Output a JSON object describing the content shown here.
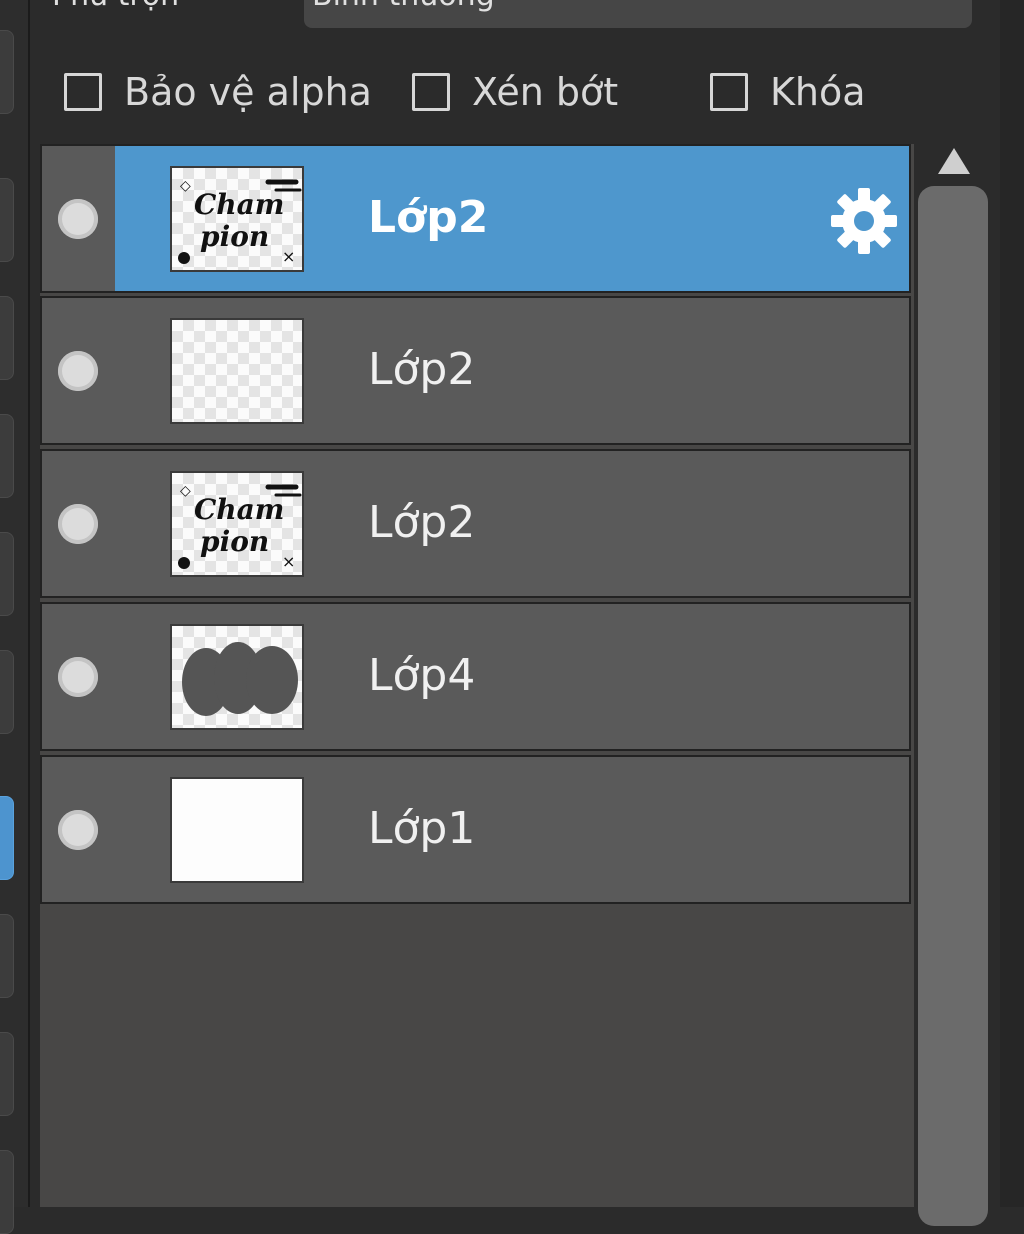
{
  "blend": {
    "label": "Phủ trộn",
    "value": "Bình thường"
  },
  "options": {
    "protect_alpha": "Bảo vệ alpha",
    "clipping": "Xén bớt",
    "lock": "Khóa"
  },
  "layers": [
    {
      "name": "Lớp2",
      "selected": true,
      "thumbnail": "champion-text-icon"
    },
    {
      "name": "Lớp2",
      "selected": false,
      "thumbnail": "transparent"
    },
    {
      "name": "Lớp2",
      "selected": false,
      "thumbnail": "champion-text-icon"
    },
    {
      "name": "Lớp4",
      "selected": false,
      "thumbnail": "gray-blobs"
    },
    {
      "name": "Lớp1",
      "selected": false,
      "thumbnail": "white-fill"
    }
  ],
  "colors": {
    "selection": "#4e97cd",
    "row": "#5a5a5a",
    "panel": "#2b2b2b"
  },
  "icons": {
    "settings": "gear-icon",
    "scroll_up": "triangle-up-icon"
  }
}
